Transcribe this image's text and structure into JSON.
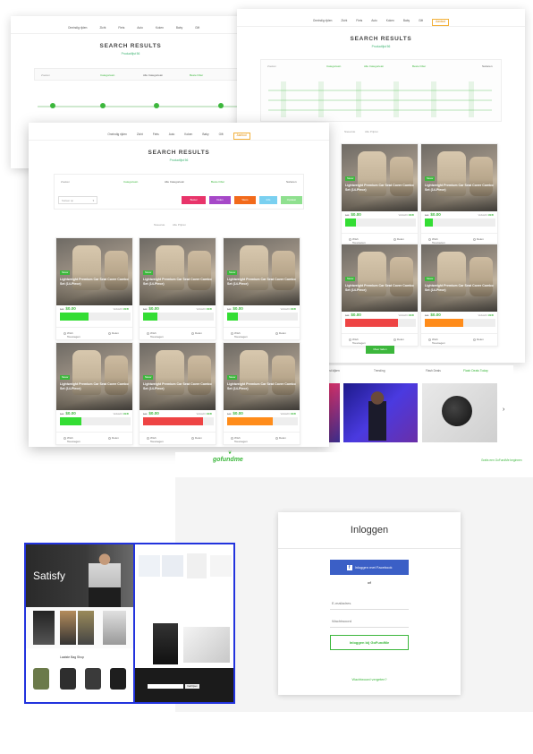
{
  "search_pages": {
    "nav_items": [
      "Oneindig rijden",
      "Zicht",
      "Fiets",
      "Auto",
      "Koken",
      "Baby",
      "Gift",
      "Aanbod"
    ],
    "title": "SEARCH RESULTS",
    "subtitle": "Productlijst 56",
    "search_placeholder": "Zoeken",
    "filter_labels": [
      "Categorieën",
      "Alle Categorieën",
      "Beste Filter"
    ],
    "sort_label": "Sorteren",
    "sort_select": "Sorteer op",
    "action_buttons": [
      "Bestel",
      "Delen",
      "Wens",
      "Info",
      "Opslaan"
    ],
    "tabs": [
      "Nieuwste",
      "Alle Prijzen"
    ],
    "more_button": "Meer laden"
  },
  "cards": [
    {
      "badge": "Nieuw",
      "title": "Lightweight Premium Car Seat Cover Combo Set (14-Piece)",
      "old_price": "$79",
      "price": "$0.00",
      "sold_label": "Verkocht",
      "sold": "13/45",
      "progress": 0.4,
      "bar_color": "#33dd33"
    },
    {
      "badge": "Nieuw",
      "title": "Lightweight Premium Car Seat Cover Combo Set (14-Piece)",
      "old_price": "$79",
      "price": "$0.00",
      "sold_label": "Verkocht",
      "sold": "13/45",
      "progress": 0.2,
      "bar_color": "#33dd33"
    },
    {
      "badge": "Nieuw",
      "title": "Lightweight Premium Car Seat Cover Combo Set (14-Piece)",
      "old_price": "$79",
      "price": "$0.00",
      "sold_label": "Verkocht",
      "sold": "13/45",
      "progress": 0.15,
      "bar_color": "#33dd33"
    },
    {
      "badge": "Nieuw",
      "title": "Lightweight Premium Car Seat Cover Combo Set (14-Piece)",
      "old_price": "$79",
      "price": "$0.00",
      "sold_label": "Verkocht",
      "sold": "13/45",
      "progress": 0.3,
      "bar_color": "#33dd33"
    },
    {
      "badge": "Nieuw",
      "title": "Lightweight Premium Car Seat Cover Combo Set (14-Piece)",
      "old_price": "$79",
      "price": "$0.00",
      "sold_label": "Verkocht",
      "sold": "13/45",
      "progress": 0.85,
      "bar_color": "#ee4444"
    },
    {
      "badge": "Nieuw",
      "title": "Lightweight Premium Car Seat Cover Combo Set (14-Piece)",
      "old_price": "$79",
      "price": "$0.00",
      "sold_label": "Verkocht",
      "sold": "13/45",
      "progress": 0.65,
      "bar_color": "#ff8c1a"
    }
  ],
  "card_actions": {
    "wishlist": "Wish Toevoegen",
    "compare": "Delen"
  },
  "right_card_bottoms": [
    {
      "progress": 0.15,
      "bar_color": "#33dd33"
    },
    {
      "progress": 0.12,
      "bar_color": "#33dd33"
    },
    {
      "progress": 0.75,
      "bar_color": "#ee4444"
    },
    {
      "progress": 0.55,
      "bar_color": "#ff8c1a"
    }
  ],
  "promo": {
    "left_label": "Meest kijken",
    "mid_label": "Trending",
    "right_label": "Flash Deals",
    "right_link": "Flash Deals Today"
  },
  "login_page": {
    "logo": "gofundme",
    "header_link": "Gratis een GoFundMe beginnen",
    "heading": "Inloggen",
    "facebook_button": "Inloggen met Facebook",
    "or_label": "of",
    "email_placeholder": "E-mailadres",
    "password_placeholder": "Wachtwoord",
    "submit_button": "Inloggen bij GoFundMe",
    "forgot_link": "Wachtwoord vergeten?"
  },
  "shop_page": {
    "hero_title": "Satisfy",
    "section_label": "Laatste Bag Shop",
    "footer_button": "Inschrijven"
  }
}
